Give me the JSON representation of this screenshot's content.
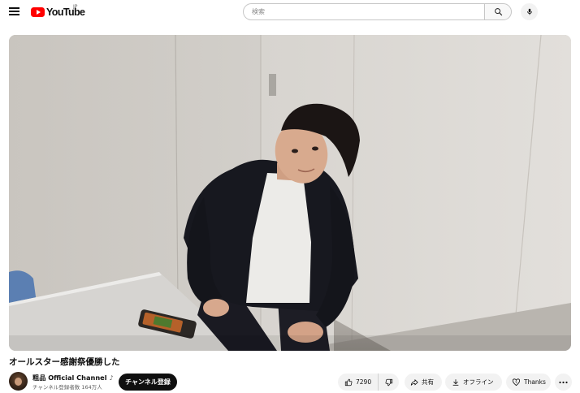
{
  "header": {
    "logo_text": "YouTube",
    "region_code": "JP",
    "search_placeholder": "検索"
  },
  "video": {
    "title": "オールスター感謝祭優勝した"
  },
  "channel": {
    "name": "粗品 Official Channel",
    "subscribers": "チャンネル登録者数 164万人",
    "subscribe_label": "チャンネル登録"
  },
  "actions": {
    "like_count": "7290",
    "share_label": "共有",
    "offline_label": "オフライン",
    "thanks_label": "Thanks"
  },
  "icons": {
    "menu": "menu-icon",
    "search": "search-icon",
    "mic": "mic-icon",
    "like": "thumbs-up-icon",
    "dislike": "thumbs-down-icon",
    "share": "share-icon",
    "download": "download-icon",
    "thanks": "super-thanks-icon",
    "more": "more-horizontal-icon"
  },
  "colors": {
    "brand_red": "#ff0000",
    "subscribe_bg": "#0f0f0f",
    "pill_bg": "#f2f2f2"
  }
}
